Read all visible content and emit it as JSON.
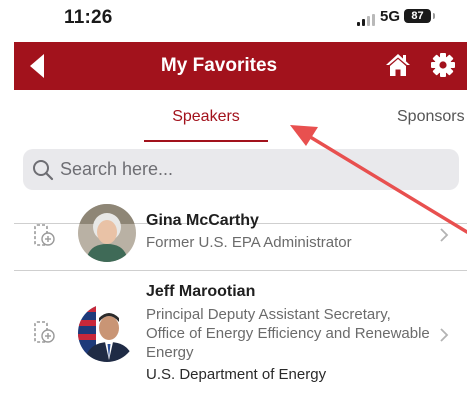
{
  "status_bar": {
    "time": "11:26",
    "network": "5G",
    "battery": "87"
  },
  "nav": {
    "title": "My Favorites",
    "back_icon": "back-arrow-icon",
    "home_icon": "home-icon",
    "settings_icon": "gear-icon",
    "bar_color": "#a2121c"
  },
  "tabs": [
    {
      "label": "Speakers",
      "active": true
    },
    {
      "label": "Sponsors",
      "active": false
    }
  ],
  "search": {
    "placeholder": "Search here...",
    "value": ""
  },
  "speakers": [
    {
      "name": "Gina McCarthy",
      "title": "Former U.S. EPA Administrator",
      "organization": ""
    },
    {
      "name": "Jeff Marootian",
      "title": "Principal Deputy Assistant Secretary, Office of Energy Efficiency and Renewable Energy",
      "organization": "U.S. Department of Energy"
    }
  ],
  "colors": {
    "accent": "#a2121c",
    "annotation_arrow": "#e8504f"
  }
}
